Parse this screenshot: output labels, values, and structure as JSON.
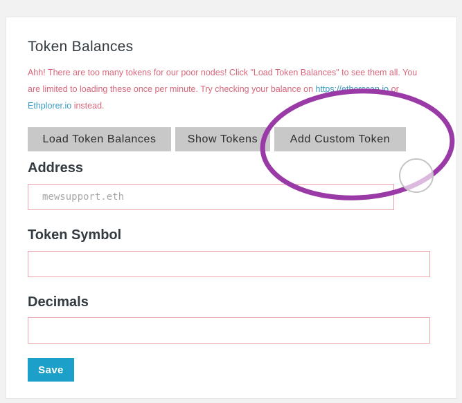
{
  "panel": {
    "title": "Token Balances",
    "warning": {
      "text_before": "Ahh! There are too many tokens for our poor nodes! Click \"Load Token Balances\" to see them all. You are limited to loading these once per minute. Try checking your balance on ",
      "link1": "https://etherscan.io",
      "or": " or ",
      "link2": "Ethplorer.io",
      "after": " instead."
    }
  },
  "toolbar": {
    "load_label": "Load Token Balances",
    "show_label": "Show Tokens",
    "add_label": "Add Custom Token"
  },
  "form": {
    "address_label": "Address",
    "address_placeholder": "mewsupport.eth",
    "address_value": "",
    "symbol_label": "Token Symbol",
    "symbol_value": "",
    "decimals_label": "Decimals",
    "decimals_value": "",
    "save_label": "Save"
  },
  "colors": {
    "warning_text": "#d9667a",
    "link": "#3a9bc2",
    "save_button": "#1ca0c9",
    "field_border": "#f0a0aa",
    "highlight_stroke": "#9a3aa6"
  }
}
